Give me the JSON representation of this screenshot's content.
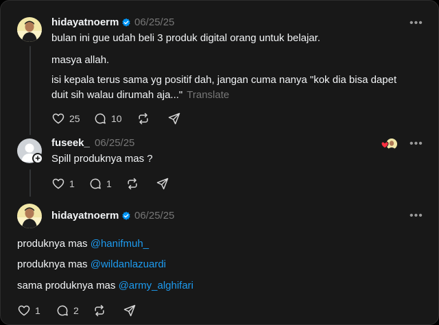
{
  "post1": {
    "username": "hidayatnoerm",
    "timestamp": "06/25/25",
    "para1": "bulan ini gue udah beli 3 produk digital orang untuk belajar.",
    "para2": "masya allah.",
    "para3_line1": "isi kepala terus sama yg positif dah, jangan cuma nanya \"kok dia bisa dapet",
    "para3_line2": "duit sih walau dirumah aja...\"",
    "translate": "Translate",
    "likes": "25",
    "replies": "10"
  },
  "post2": {
    "username": "fuseek_",
    "timestamp": "06/25/25",
    "text": "Spill produknya mas ?",
    "likes": "1",
    "replies": "1"
  },
  "post3": {
    "username": "hidayatnoerm",
    "timestamp": "06/25/25",
    "line1_prefix": "produknya mas ",
    "line1_mention": "@hanifmuh_",
    "line2_prefix": "produknya mas ",
    "line2_mention": "@wildanlazuardi",
    "line3_prefix": "sama produknya mas ",
    "line3_mention": "@army_alghifari",
    "likes": "1",
    "replies": "2"
  },
  "colors": {
    "background": "#181818",
    "text": "#f3f5f7",
    "muted": "#777777",
    "mention": "#1d9bf0",
    "verified": "#0095f6"
  },
  "icons": [
    "heart-icon",
    "comment-icon",
    "repost-icon",
    "share-icon",
    "verified-icon",
    "more-icon"
  ],
  "more_label": "•••"
}
